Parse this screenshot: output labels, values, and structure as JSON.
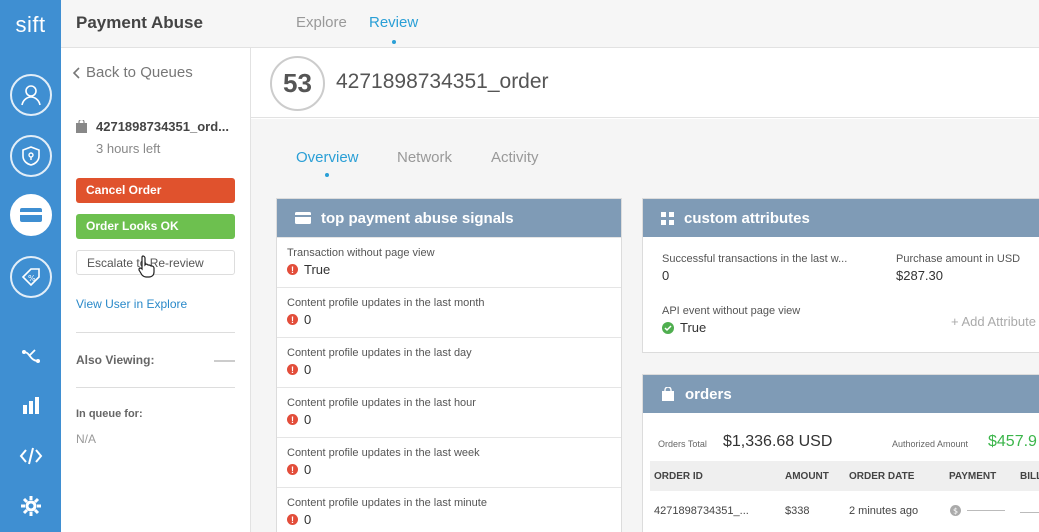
{
  "rail": {
    "logo": "sift",
    "icons": [
      "user-icon",
      "shield-icon",
      "credit-card-icon",
      "promo-tag-icon",
      "workflow-icon",
      "bar-chart-icon",
      "code-icon",
      "gear-icon"
    ]
  },
  "queue": {
    "title": "Payment Abuse",
    "back_label": "Back to Queues",
    "item_name": "4271898734351_ord...",
    "item_time": "3 hours left",
    "cancel_label": "Cancel Order",
    "ok_label": "Order Looks OK",
    "escalate_label": "Escalate to Re-review",
    "view_user_label": "View User in Explore",
    "also_viewing_label": "Also Viewing:",
    "in_queue_label": "In queue for:",
    "in_queue_value": "N/A"
  },
  "header": {
    "tabs": [
      {
        "label": "Explore"
      },
      {
        "label": "Review"
      }
    ]
  },
  "order": {
    "score": "53",
    "id": "4271898734351_order"
  },
  "tabs": [
    {
      "label": "Overview"
    },
    {
      "label": "Network"
    },
    {
      "label": "Activity"
    }
  ],
  "signals": {
    "title": "top payment abuse signals",
    "rows": [
      {
        "label": "Transaction without page view",
        "value": "True"
      },
      {
        "label": "Content profile updates in the last month",
        "value": "0"
      },
      {
        "label": "Content profile updates in the last day",
        "value": "0"
      },
      {
        "label": "Content profile updates in the last hour",
        "value": "0"
      },
      {
        "label": "Content profile updates in the last week",
        "value": "0"
      },
      {
        "label": "Content profile updates in the last minute",
        "value": "0"
      }
    ]
  },
  "attributes": {
    "title": "custom attributes",
    "items": [
      {
        "label": "Successful transactions in the last w...",
        "value": "0"
      },
      {
        "label": "Purchase amount in USD",
        "value": "$287.30"
      },
      {
        "label": "API event without page view",
        "value": "True"
      }
    ],
    "add_label": "+ Add Attribute"
  },
  "orders": {
    "title": "orders",
    "total_label": "Orders Total",
    "total_value": "$1,336.68 USD",
    "authorized_label": "Authorized Amount",
    "authorized_value": "$457.9",
    "columns": [
      "ORDER ID",
      "AMOUNT",
      "ORDER DATE",
      "PAYMENT",
      "BILL"
    ],
    "rows": [
      {
        "order_id": "4271898734351_...",
        "amount": "$338",
        "date": "2 minutes ago"
      }
    ]
  },
  "colors": {
    "rail": "#3f8fd2",
    "accent": "#2a9fd6",
    "cancel": "#e0522d",
    "ok": "#6dc04f",
    "panel_header": "#7f9bb6",
    "authorized": "#3bb54a"
  }
}
